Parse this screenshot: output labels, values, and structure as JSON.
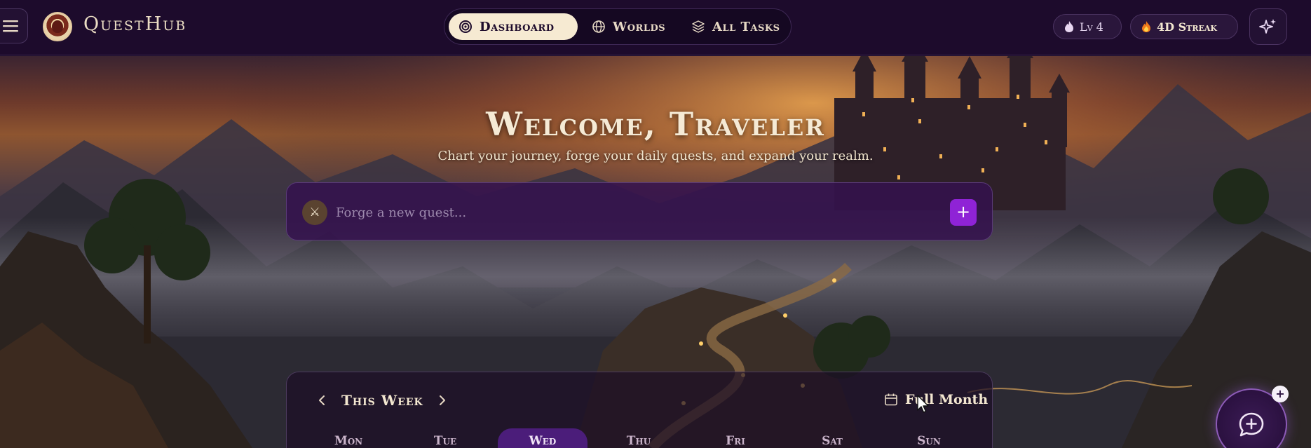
{
  "app": {
    "brand": "QuestHub"
  },
  "nav": {
    "tabs": [
      {
        "label": "Dashboard",
        "icon": "target-icon",
        "active": true
      },
      {
        "label": "Worlds",
        "icon": "globe-icon",
        "active": false
      },
      {
        "label": "All Tasks",
        "icon": "layers-icon",
        "active": false
      }
    ]
  },
  "status": {
    "level_label": "Lv 4",
    "streak_label": "4D Streak"
  },
  "hero": {
    "title": "Welcome, Traveler",
    "subtitle": "Chart your journey, forge your daily quests, and expand your realm.",
    "quest_placeholder": "Forge a new quest...",
    "quest_icon": "crossed-swords-icon",
    "add_label": "+"
  },
  "week": {
    "label": "This Week",
    "full_month_label": "Full Month",
    "days": [
      {
        "label": "Mon",
        "active": false
      },
      {
        "label": "Tue",
        "active": false
      },
      {
        "label": "Wed",
        "active": true
      },
      {
        "label": "Thu",
        "active": false
      },
      {
        "label": "Fri",
        "active": false
      },
      {
        "label": "Sat",
        "active": false
      },
      {
        "label": "Sun",
        "active": false
      }
    ]
  },
  "fab": {
    "icon": "chat-plus-icon",
    "badge": "+"
  },
  "colors": {
    "topbar_bg": "#1d0b2c",
    "accent_purple": "#8f23d6",
    "active_tab_bg": "#f6ead2",
    "text_cream": "#f1e6cf"
  }
}
